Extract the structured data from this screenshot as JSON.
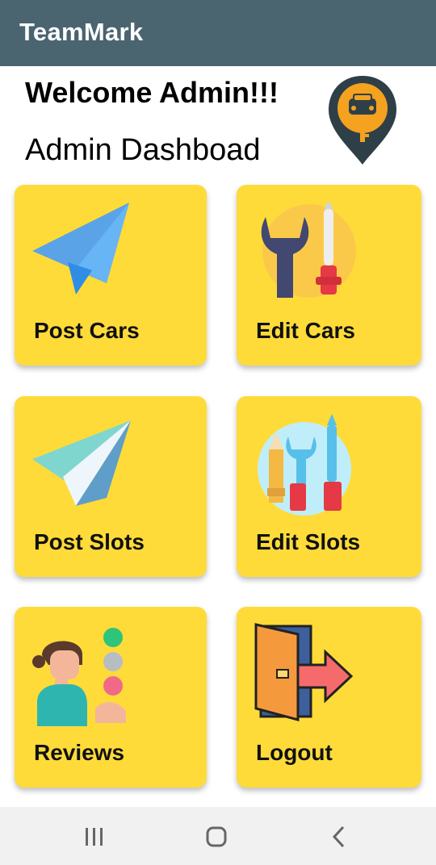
{
  "app": {
    "title": "TeamMark"
  },
  "header": {
    "welcome": "Welcome Admin!!!",
    "subtitle": "Admin Dashboad"
  },
  "cards": [
    {
      "label": "Post Cars",
      "icon": "paper-plane-icon"
    },
    {
      "label": "Edit Cars",
      "icon": "wrench-screwdriver-icon"
    },
    {
      "label": "Post Slots",
      "icon": "paper-plane-icon"
    },
    {
      "label": "Edit Slots",
      "icon": "tools-icon"
    },
    {
      "label": "Reviews",
      "icon": "reviews-icon"
    },
    {
      "label": "Logout",
      "icon": "logout-door-icon"
    }
  ],
  "colors": {
    "appbar": "#4a6470",
    "card": "#ffdb3a",
    "navbar": "#f1f1f1"
  },
  "navigation": [
    "recent-apps-icon",
    "home-icon",
    "back-icon"
  ]
}
